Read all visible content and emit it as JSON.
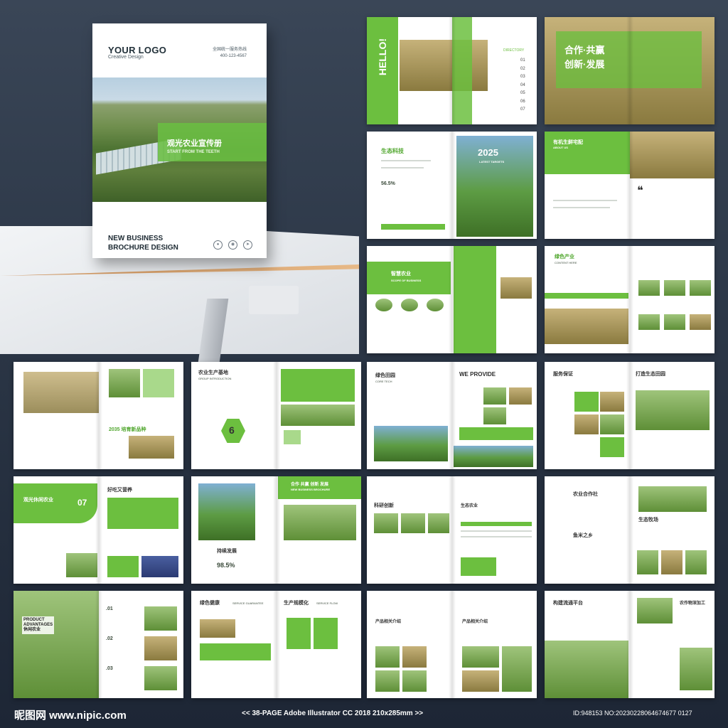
{
  "cover": {
    "logo": "YOUR LOGO",
    "logo_sub": "Creative Design",
    "hotline_label": "全国统一服务热线",
    "hotline": "400-123-4567",
    "title_cn": "观光农业宣传册",
    "title_en": "START FROM THE TEETH",
    "bottom_line1": "NEW BUSINESS",
    "bottom_line2": "BROCHURE DESIGN"
  },
  "spreads": {
    "hello": "HELLO!",
    "directory": "DIRECTORY",
    "dir_nums": [
      "01",
      "02",
      "03",
      "04",
      "05",
      "06",
      "07"
    ],
    "coop": "合作·共赢",
    "innov": "创新·发展",
    "eco_tech": "生态科技",
    "year": "2025",
    "latest": "LATEST TARGETS",
    "pct": "56.5%",
    "organic": "有机生鲜宅配",
    "about": "ABOUT US",
    "smart": "智慧农业",
    "scope": "SCOPE OF BUSINESS",
    "green_ind": "绿色产业",
    "content_here": "CONTENT HERE",
    "breed": "2035 培育新品种",
    "base": "农业生产基地",
    "group_intro": "GROUP INTRODUCTION",
    "six": "6",
    "green_field": "绿色田园",
    "core_tech": "CORE TECH",
    "we_provide": "WE PROVIDE",
    "service": "服务保证",
    "build_field": "打造生态田园",
    "leisure": "观光休闲农业",
    "num07": "07",
    "good_taste": "好吃又营养",
    "coop2": "合作 共赢 创新 发展",
    "nbb": "NEW BUSINESS BROCHURE",
    "sustain": "持续发展",
    "pct2": "98.5%",
    "research": "科研创新",
    "eco_farm": "生态农业",
    "agri_coop": "农业合作社",
    "eco_pasture": "生态牧场",
    "fish_rice": "鱼米之乡",
    "product_adv1": "PRODUCT",
    "product_adv2": "ADVANTAGES",
    "leisure2": "休闲农业",
    "d01": ".01",
    "d02": ".02",
    "d03": ".03",
    "green_health": "绿色健康",
    "service_guar": "SERVICE GUARANTEE",
    "prod_scale": "生产规模化",
    "service_flow": "SERVICE FLOW",
    "product_intro": "产品相关介绍",
    "platform": "构建流通平台",
    "deep_proc": "农作物深加工"
  },
  "footer": {
    "site": "昵图网 www.nipic.com",
    "info": "<< 38-PAGE  Adobe Illustrator CC 2018  210x285mm >>",
    "id": "ID:948153 NO:20230228064674677 0127"
  },
  "colors": {
    "accent": "#6cbf3f",
    "light": "#a9d98b",
    "bg": "#2b3646"
  }
}
